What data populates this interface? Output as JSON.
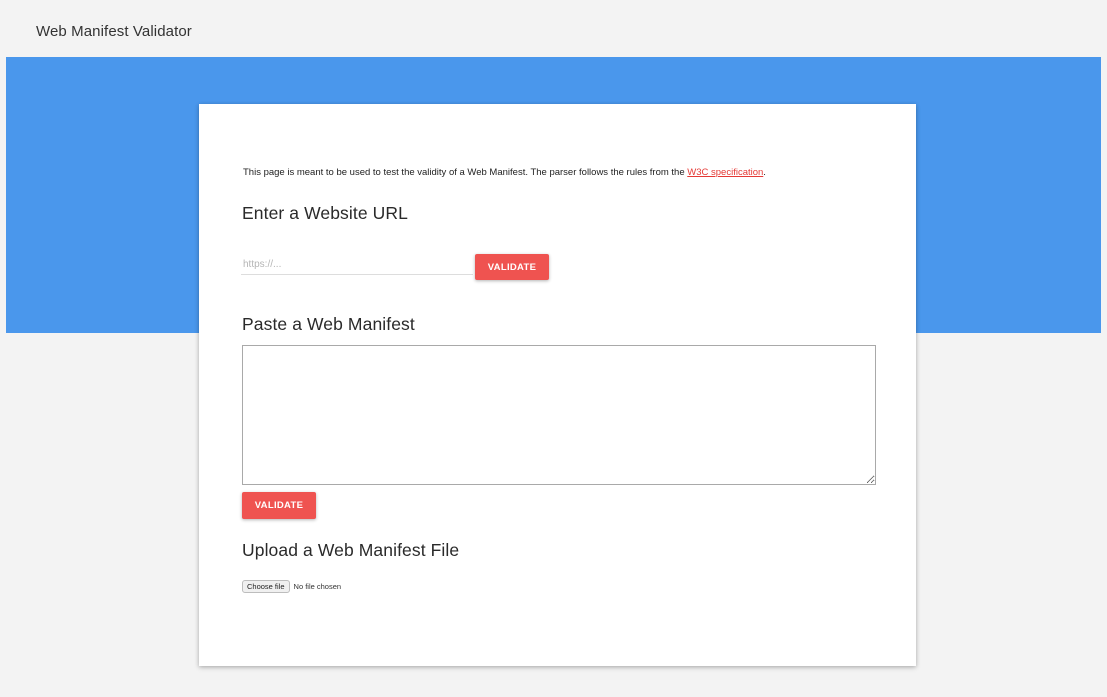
{
  "header": {
    "title": "Web Manifest Validator"
  },
  "colors": {
    "hero": "#4a97ec",
    "accent": "#ef5350",
    "link": "#e53935"
  },
  "intro": {
    "text": "This page is meant to be used to test the validity of a Web Manifest. The parser follows the rules from the ",
    "link_text": "W3C specification",
    "suffix": "."
  },
  "url_section": {
    "heading": "Enter a Website URL",
    "input_placeholder": "https://...",
    "input_value": "",
    "button_label": "VALIDATE"
  },
  "paste_section": {
    "heading": "Paste a Web Manifest",
    "textarea_value": "",
    "button_label": "VALIDATE"
  },
  "upload_section": {
    "heading": "Upload a Web Manifest File",
    "choose_button_label": "Choose file",
    "status_text": "No file chosen"
  }
}
